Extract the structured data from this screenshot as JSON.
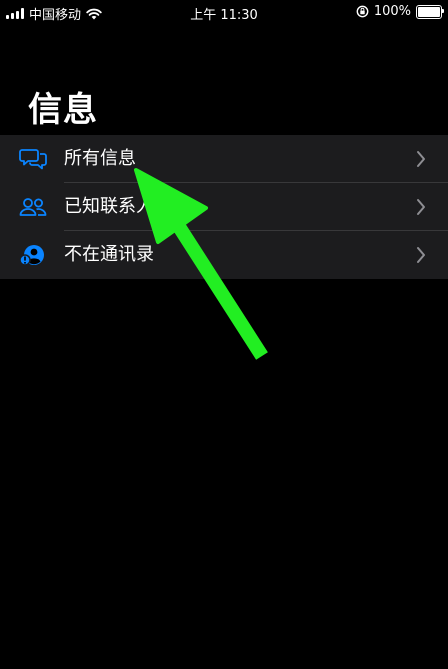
{
  "status_bar": {
    "carrier": "中国移动",
    "time": "上午 11:30",
    "battery": "100%",
    "battery_level": 1.0
  },
  "page": {
    "title": "信息"
  },
  "list": {
    "items": [
      {
        "label": "所有信息",
        "icon": "chat-bubbles-icon"
      },
      {
        "label": "已知联系人",
        "icon": "people-icon"
      },
      {
        "label": "不在通讯录",
        "icon": "unknown-person-icon"
      }
    ]
  },
  "colors": {
    "accent": "#0a84ff",
    "background": "#000000",
    "list_background": "#1c1c1e",
    "chevron": "#8e8e93",
    "annotation_arrow": "#22ee22"
  }
}
